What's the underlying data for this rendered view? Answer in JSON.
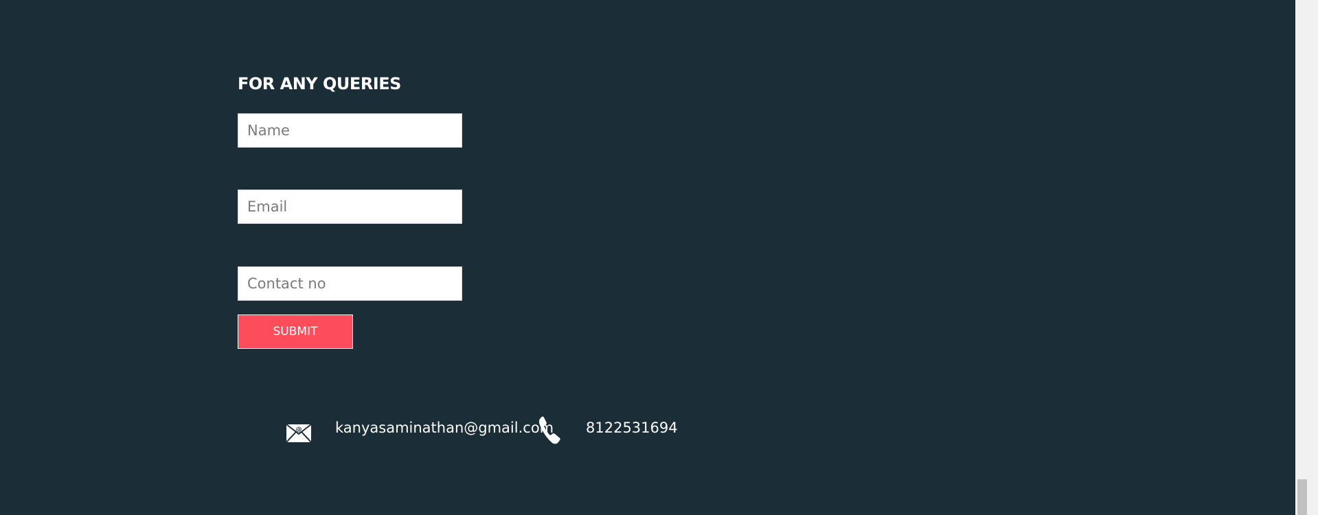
{
  "form": {
    "heading": "FOR ANY QUERIES",
    "name_placeholder": "Name",
    "email_placeholder": "Email",
    "contact_placeholder": "Contact no",
    "submit_label": "SUBMIT"
  },
  "contact": {
    "email_icon": "envelope-at-icon",
    "email": "kanyasaminathan@gmail.com",
    "phone_icon": "telephone-handset-icon",
    "phone": "8122531694"
  },
  "colors": {
    "background": "#1b2d36",
    "submit_button": "#fe4d5a",
    "text": "#ffffff"
  }
}
